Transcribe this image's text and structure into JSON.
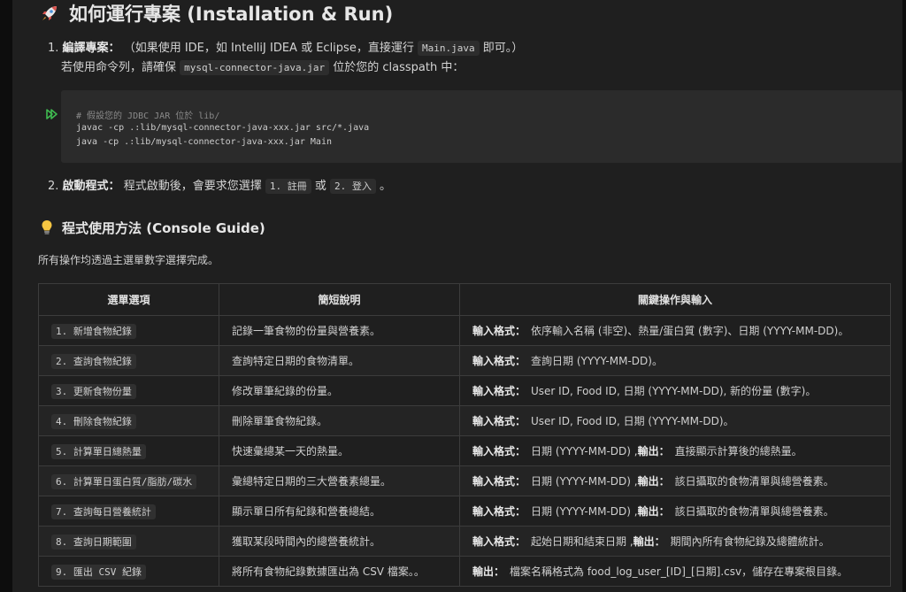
{
  "install": {
    "title": "如何運行專案 (Installation & Run)",
    "step1": {
      "num": "1.",
      "label": "編譯專案：",
      "text_a": "（如果使用 IDE，如 IntelliJ IDEA 或 Eclipse，直接運行",
      "code_main": "Main.java",
      "text_b": "即可。）",
      "line2_a": "若使用命令列，請確保",
      "code_jar": "mysql-connector-java.jar",
      "line2_b": "位於您的 classpath 中："
    },
    "code_lines": [
      "# 假設您的 JDBC JAR 位於 lib/",
      "javac -cp .:lib/mysql-connector-java-xxx.jar src/*.java",
      "java -cp .:lib/mysql-connector-java-xxx.jar Main"
    ],
    "step2": {
      "num": "2.",
      "label": "啟動程式：",
      "text_a": "程式啟動後，會要求您選擇",
      "code_1": "1. 註冊",
      "or": "或",
      "code_2": "2. 登入",
      "end": "。"
    }
  },
  "guide": {
    "title": "程式使用方法 (Console Guide)",
    "intro": "所有操作均透過主選單數字選擇完成。",
    "headers": [
      "選單選項",
      "簡短說明",
      "關鍵操作與輸入"
    ],
    "rows": [
      {
        "option": "1. 新增食物紀錄",
        "desc": "記錄一筆食物的份量與營養素。",
        "k1": "輸入格式：",
        "v1": "依序輸入名稱 (非空)、熱量/蛋白質 (數字)、日期 (YYYY-MM-DD)。",
        "k2": "",
        "v2": ""
      },
      {
        "option": "2. 查詢食物紀錄",
        "desc": "查詢特定日期的食物清單。",
        "k1": "輸入格式：",
        "v1": "查詢日期 (YYYY-MM-DD)。",
        "k2": "",
        "v2": ""
      },
      {
        "option": "3. 更新食物份量",
        "desc": "修改單筆紀錄的份量。",
        "k1": "輸入格式：",
        "v1": "User ID, Food ID, 日期 (YYYY-MM-DD), 新的份量 (數字)。",
        "k2": "",
        "v2": ""
      },
      {
        "option": "4. 刪除食物紀錄",
        "desc": "刪除單筆食物紀錄。",
        "k1": "輸入格式：",
        "v1": "User ID, Food ID, 日期 (YYYY-MM-DD)。",
        "k2": "",
        "v2": ""
      },
      {
        "option": "5. 計算單日總熱量",
        "desc": "快速彙總某一天的熱量。",
        "k1": "輸入格式：",
        "v1": "日期 (YYYY-MM-DD) ,",
        "k2": "輸出：",
        "v2": "直接顯示計算後的總熱量。"
      },
      {
        "option": "6. 計算單日蛋白質/脂肪/碳水",
        "desc": "彙總特定日期的三大營養素總量。",
        "k1": "輸入格式：",
        "v1": "日期 (YYYY-MM-DD) ,",
        "k2": "輸出：",
        "v2": "該日攝取的食物清單與總營養素。"
      },
      {
        "option": "7. 查詢每日營養統計",
        "desc": "顯示單日所有紀錄和營養總結。",
        "k1": "輸入格式：",
        "v1": "日期 (YYYY-MM-DD) ,",
        "k2": "輸出：",
        "v2": "該日攝取的食物清單與總營養素。"
      },
      {
        "option": "8. 查詢日期範圍",
        "desc": "獲取某段時間內的總營養統計。",
        "k1": "輸入格式：",
        "v1": "起始日期和結束日期 ,",
        "k2": "輸出：",
        "v2": "期間內所有食物紀錄及總體統計。"
      },
      {
        "option": "9. 匯出 CSV 紀錄",
        "desc": "將所有食物紀錄數據匯出為 CSV 檔案。。",
        "k1": "輸出：",
        "v1": "檔案名稱格式為 food_log_user_[ID]_[日期].csv，儲存在專案根目錄。",
        "k2": "",
        "v2": ""
      }
    ]
  },
  "icons": {
    "rocket": "rocket-icon",
    "run": "run-code-icon",
    "bulb": "lightbulb-icon"
  },
  "colors": {
    "page_bg": "#1f1f1f",
    "code_bg": "#2b2b2b",
    "run_icon": "#3fb950",
    "rocket": "#d9534f",
    "bulb": "#f5c542"
  }
}
